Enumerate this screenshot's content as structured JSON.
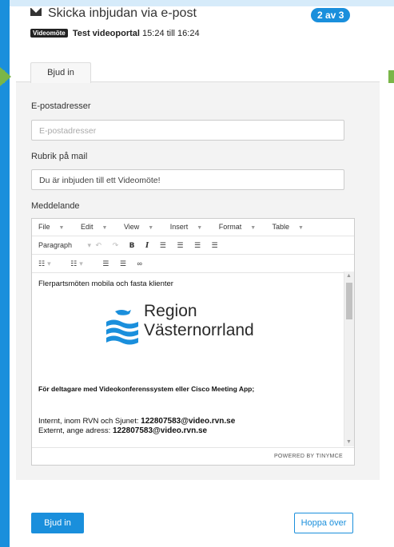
{
  "header": {
    "title": "Skicka inbjudan via e-post",
    "step_badge": "2 av 3",
    "meeting_tag": "Videomöte",
    "meeting_name": "Test videoportal",
    "meeting_time": "15:24 till 16:24"
  },
  "tabs": [
    {
      "label": "Bjud in"
    }
  ],
  "form": {
    "email_label": "E-postadresser",
    "email_placeholder": "E-postadresser",
    "subject_label": "Rubrik på mail",
    "subject_value": "Du är inbjuden till ett Videomöte!",
    "message_label": "Meddelande"
  },
  "editor": {
    "menu": [
      "File",
      "Edit",
      "View",
      "Insert",
      "Format",
      "Table"
    ],
    "paragraph_select": "Paragraph",
    "content": {
      "line1": "Flerpartsmöten mobila och fasta klienter",
      "logo_line1": "Region",
      "logo_line2": "Västernorrland",
      "participants_heading": "För deltagare med Videokonferenssystem eller Cisco Meeting App;",
      "internal_prefix": "Internt, inom RVN och Sjunet: ",
      "internal_address": "122807583@video.rvn.se",
      "external_prefix": "Externt, ange adress: ",
      "external_address": "122807583@video.rvn.se"
    },
    "powered_by": "POWERED BY TINYMCE"
  },
  "actions": {
    "invite_button": "Bjud in",
    "skip_button": "Hoppa över"
  },
  "colors": {
    "accent": "#1a8fdc",
    "arrow_green": "#7ab648",
    "panel_bg": "#f3f3f3"
  }
}
